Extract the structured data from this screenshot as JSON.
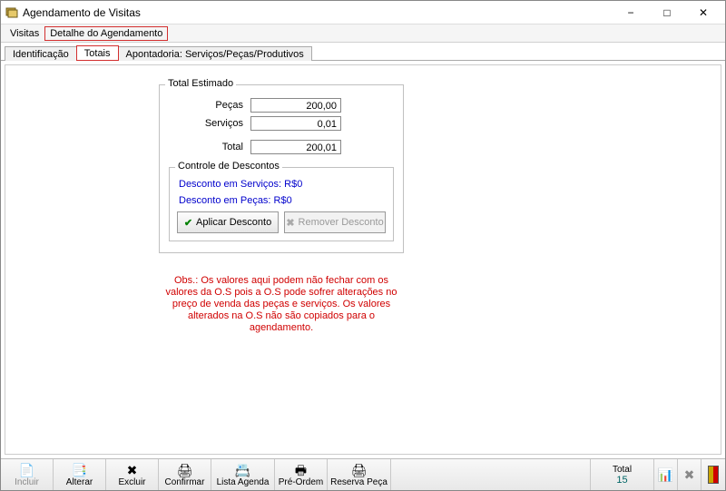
{
  "window": {
    "title": "Agendamento de Visitas",
    "min_label": "−",
    "max_label": "□",
    "close_label": "✕"
  },
  "menubar": {
    "items": [
      "Visitas",
      "Detalhe do Agendamento"
    ]
  },
  "tabs": {
    "items": [
      "Identificação",
      "Totais",
      "Apontadoria: Serviços/Peças/Produtivos"
    ]
  },
  "total_estimado": {
    "group_title": "Total Estimado",
    "pecas_label": "Peças",
    "pecas_value": "200,00",
    "servicos_label": "Serviços",
    "servicos_value": "0,01",
    "total_label": "Total",
    "total_value": "200,01"
  },
  "controle_descontos": {
    "group_title": "Controle de Descontos",
    "desc_servicos": "Desconto em Serviços: R$0",
    "desc_pecas": "Desconto em Peças: R$0",
    "aplicar_label": "Aplicar Desconto",
    "remover_label": "Remover Desconto",
    "check_glyph": "✔",
    "x_glyph": "✖"
  },
  "obs_text": "Obs.: Os valores aqui podem não fechar com os valores da O.S pois a O.S pode sofrer alterações no preço de venda das peças e serviços. Os valores alterados na O.S não são copiados para o agendamento.",
  "toolbar": {
    "incluir": "Incluir",
    "alterar": "Alterar",
    "excluir": "Excluir",
    "confirmar": "Confirmar",
    "lista_agenda": "Lista Agenda",
    "pre_ordem": "Pré-Ordem",
    "reserva_peca": "Reserva Peça",
    "total_label": "Total",
    "total_value": "15",
    "icons": {
      "incluir": "📄",
      "alterar": "📑",
      "excluir": "✖",
      "confirmar": "🖨",
      "lista_agenda": "📇",
      "pre_ordem": "🖶",
      "reserva_peca": "🖨",
      "chart": "📊",
      "refresh": "✖"
    }
  }
}
